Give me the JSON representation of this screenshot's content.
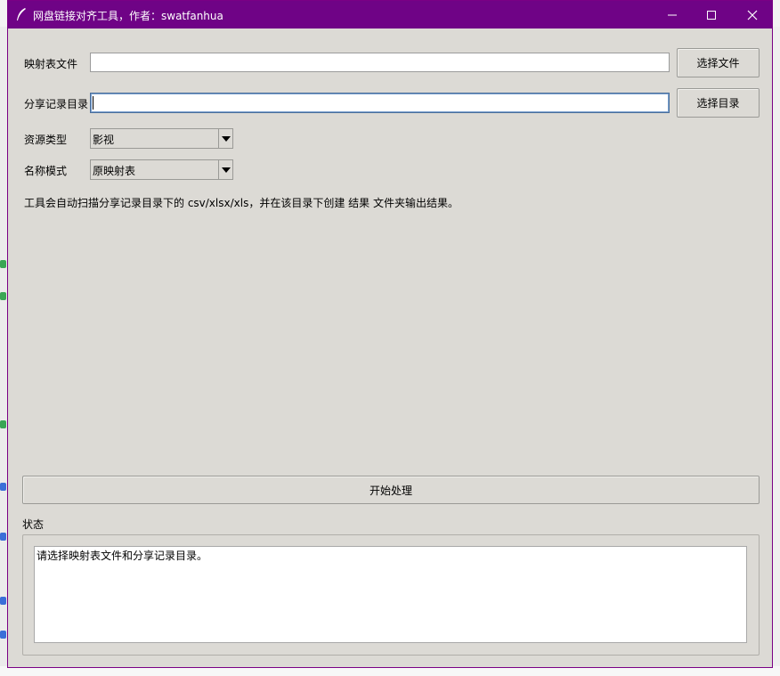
{
  "window": {
    "title": "网盘链接对齐工具，作者：swatfanhua",
    "title_bar_color": "#6f0386",
    "background_color": "#dcdad5"
  },
  "form": {
    "mapping_file": {
      "label": "映射表文件",
      "value": "",
      "button": "选择文件"
    },
    "share_dir": {
      "label": "分享记录目录",
      "value": "",
      "button": "选择目录"
    },
    "resource_type": {
      "label": "资源类型",
      "selected": "影视"
    },
    "name_mode": {
      "label": "名称模式",
      "selected": "原映射表"
    },
    "hint": "工具会自动扫描分享记录目录下的 csv/xlsx/xls，并在该目录下创建 结果 文件夹输出结果。"
  },
  "actions": {
    "start_button": "开始处理"
  },
  "status": {
    "label": "状态",
    "text": "请选择映射表文件和分享记录目录。"
  },
  "icons": {
    "app": "feather-icon",
    "minimize": "minimize-icon",
    "maximize": "maximize-icon",
    "close": "close-icon",
    "dropdown": "chevron-down-icon"
  }
}
